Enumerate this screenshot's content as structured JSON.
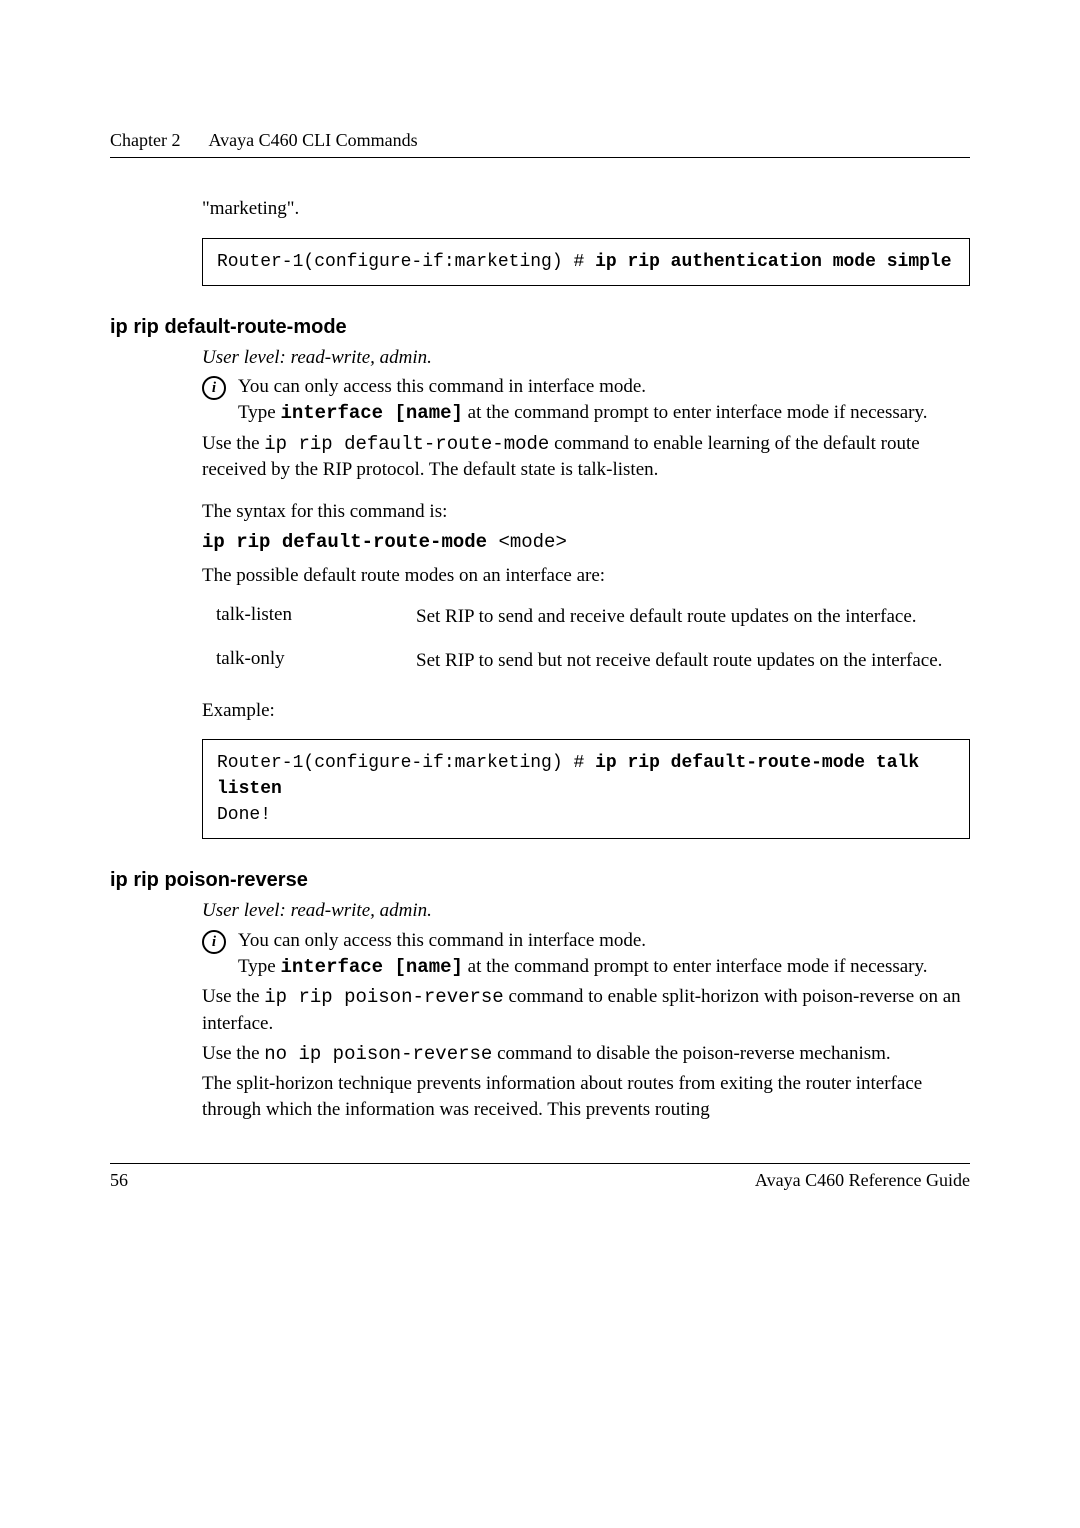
{
  "header": {
    "chapter": "Chapter 2",
    "title": "Avaya C460 CLI Commands"
  },
  "continuation": "\"marketing\".",
  "codebox1": {
    "prefix": "Router-1(configure-if:marketing) # ",
    "cmd": "ip rip authentication mode simple"
  },
  "section1": {
    "heading": "ip rip default-route-mode",
    "userlevel": "User level: read-write, admin.",
    "note_line1": "You can only access this command in interface mode.",
    "note_line2a": "Type ",
    "note_line2_cmd": "interface [name]",
    "note_line2b": " at the command prompt to enter interface mode if necessary.",
    "para1a": "Use the ",
    "para1_cmd": "ip rip default-route-mode",
    "para1b": " command to enable learning of the default route received by the RIP protocol. The default state is talk-listen.",
    "syntax_intro": "The syntax for this command is:",
    "syntax_cmd": "ip rip default-route-mode ",
    "syntax_arg": "<mode>",
    "modes_intro": "The possible default route modes on an interface are:",
    "modes": [
      {
        "name": "talk-listen",
        "desc": "Set RIP to send and receive default route updates on the interface."
      },
      {
        "name": "talk-only",
        "desc": "Set RIP to send but not receive default route updates on the interface."
      }
    ],
    "example_label": "Example:"
  },
  "codebox2": {
    "prefix": "Router-1(configure-if:marketing) # ",
    "cmd": "ip rip default-route-mode talk listen",
    "result": "Done!"
  },
  "section2": {
    "heading": "ip rip poison-reverse",
    "userlevel": "User level: read-write, admin.",
    "note_line1": "You can only access this command in interface mode.",
    "note_line2a": "Type ",
    "note_line2_cmd": "interface [name]",
    "note_line2b": " at the command prompt to enter interface mode if necessary.",
    "para1a": "Use the ",
    "para1_cmd": "ip rip poison-reverse",
    "para1b": " command to enable split-horizon with poison-reverse on an interface.",
    "para2a": "Use the ",
    "para2_cmd": "no ip poison-reverse",
    "para2b": " command to disable the poison-reverse mechanism.",
    "para3": "The split-horizon technique prevents information about routes from exiting the router interface through which the information was received. This prevents routing"
  },
  "footer": {
    "page": "56",
    "doc": "Avaya C460 Reference Guide"
  }
}
